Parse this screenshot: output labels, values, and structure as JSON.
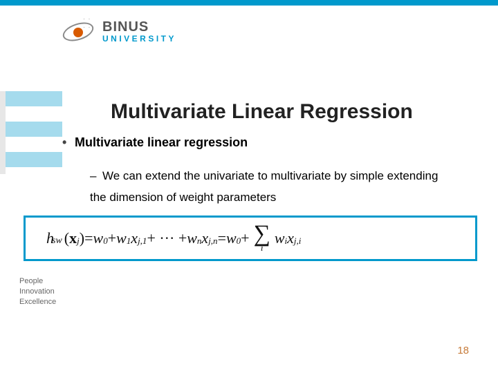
{
  "brand": {
    "name": "BINUS",
    "sub": "UNIVERSITY"
  },
  "title": "Multivariate Linear Regression",
  "bullet": "Multivariate linear regression",
  "subbullet": "We can extend the univariate to multivariate by simple extending the dimension of weight parameters",
  "formula": {
    "lhs_func": "h",
    "lhs_sub": "sw",
    "arg_x": "x",
    "arg_sub": "j",
    "eq": " = ",
    "w0": "w",
    "zero": "0",
    "plus": " + ",
    "w1": "w",
    "one": "1",
    "x": "x",
    "j1": "j,1",
    "dots": " + ··· + ",
    "wn": "w",
    "n": "n",
    "jn": "j,n",
    "wi": "w",
    "i": "i",
    "ji": "j,i",
    "sigma_sub": "i"
  },
  "tagline": {
    "l1": "People",
    "l2": "Innovation",
    "l3": "Excellence"
  },
  "page": "18"
}
